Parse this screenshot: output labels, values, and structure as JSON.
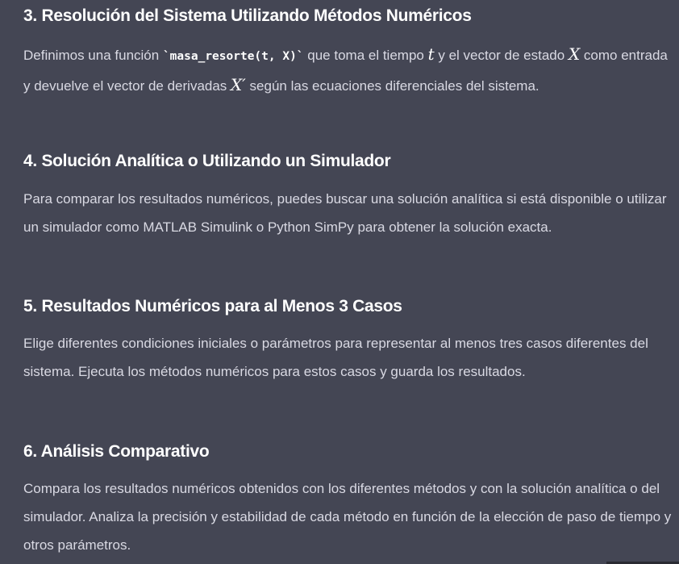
{
  "sections": [
    {
      "heading": "3. Resolución del Sistema Utilizando Métodos Numéricos",
      "text_a": "Definimos una función ",
      "code": "`masa_resorte(t, X)`",
      "text_b": " que toma el tiempo ",
      "math_t": "t",
      "text_c": " y el vector de estado ",
      "math_x": "X",
      "text_d": " como entrada y devuelve el vector de derivadas ",
      "math_xp": "X′",
      "text_e": " según las ecuaciones diferenciales del sistema."
    },
    {
      "heading": "4. Solución Analítica o Utilizando un Simulador",
      "body": "Para comparar los resultados numéricos, puedes buscar una solución analítica si está disponible o utilizar un simulador como MATLAB Simulink o Python SimPy para obtener la solución exacta."
    },
    {
      "heading": "5. Resultados Numéricos para al Menos 3 Casos",
      "body": "Elige diferentes condiciones iniciales o parámetros para representar al menos tres casos diferentes del sistema. Ejecuta los métodos numéricos para estos casos y guarda los resultados."
    },
    {
      "heading": "6. Análisis Comparativo",
      "body": "Compara los resultados numéricos obtenidos con los diferentes métodos y con la solución analítica o del simulador. Analiza la precisión y estabilidad de cada método en función de la elección de paso de tiempo y otros parámetros."
    }
  ]
}
